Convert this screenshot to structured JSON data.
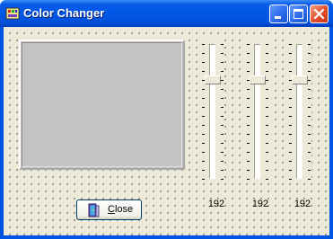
{
  "window": {
    "title": "Color Changer"
  },
  "titlebar_buttons": {
    "minimize": "minimize-icon",
    "maximize": "maximize-icon",
    "close": "close-icon"
  },
  "preview": {
    "color": "#c0c0c0"
  },
  "sliders": [
    {
      "channel": "red",
      "value": "192",
      "level_fraction": 0.247
    },
    {
      "channel": "green",
      "value": "192",
      "level_fraction": 0.247
    },
    {
      "channel": "blue",
      "value": "192",
      "level_fraction": 0.247
    }
  ],
  "close_button": {
    "label": "Close",
    "icon": "door-exit-icon"
  }
}
